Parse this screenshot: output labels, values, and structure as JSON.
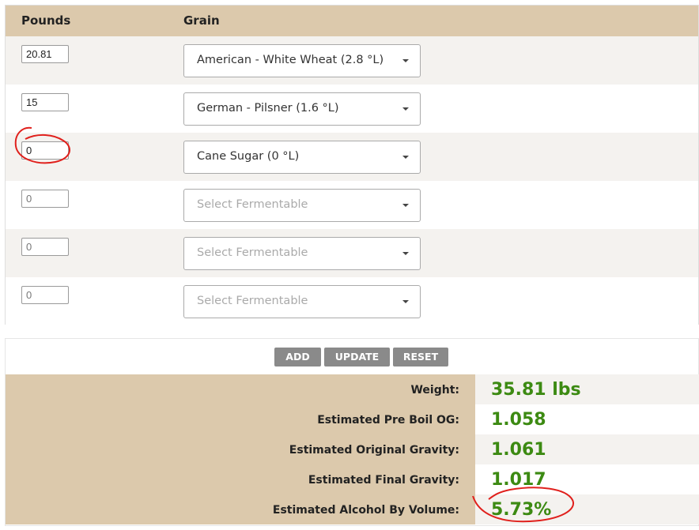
{
  "table": {
    "headers": {
      "pounds": "Pounds",
      "grain": "Grain"
    },
    "rows": [
      {
        "pounds": "20.81",
        "grain": "American - White Wheat (2.8 °L)"
      },
      {
        "pounds": "15",
        "grain": "German - Pilsner (1.6 °L)"
      },
      {
        "pounds": "0",
        "grain": "Cane Sugar (0 °L)"
      },
      {
        "pounds": "0",
        "grain": "Select Fermentable"
      },
      {
        "pounds": "0",
        "grain": "Select Fermentable"
      },
      {
        "pounds": "0",
        "grain": "Select Fermentable"
      }
    ]
  },
  "buttons": {
    "add": "ADD",
    "update": "UPDATE",
    "reset": "RESET"
  },
  "stats": [
    {
      "label": "Weight:",
      "value": "35.81 lbs"
    },
    {
      "label": "Estimated Pre Boil OG:",
      "value": "1.058"
    },
    {
      "label": "Estimated Original Gravity:",
      "value": "1.061"
    },
    {
      "label": "Estimated Final Gravity:",
      "value": "1.017"
    },
    {
      "label": "Estimated Alcohol By Volume:",
      "value": "5.73%"
    }
  ],
  "colors": {
    "header_bg": "#dcc9ac",
    "value_green": "#3c8a12",
    "button_gray": "#8a8a8a",
    "annotation_red": "#e0201c"
  },
  "icons": {
    "select_arrow": "chevron-down-icon"
  }
}
